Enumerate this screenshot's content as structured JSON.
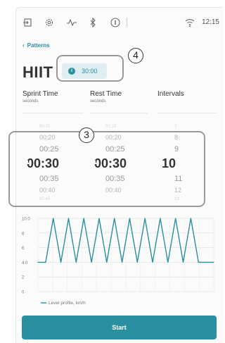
{
  "status_bar": {
    "icons": [
      "exit-icon",
      "settings-gear-icon",
      "heart-rate-icon",
      "bluetooth-icon",
      "info-icon",
      "wifi-icon"
    ],
    "time": "12:15"
  },
  "header": {
    "back_label": "Patterns",
    "title": "HIIT",
    "duration": "30:00"
  },
  "annotations": {
    "box_4": "4",
    "box_3": "3"
  },
  "columns": [
    {
      "title": "Sprint Time",
      "subtitle": "seconds"
    },
    {
      "title": "Rest Time",
      "subtitle": "seconds"
    },
    {
      "title": "Intervals",
      "subtitle": ""
    }
  ],
  "pickers": {
    "sprint": {
      "above": [
        "00:20",
        "00:25"
      ],
      "selected": "00:30",
      "below": [
        "00:35",
        "00:40"
      ]
    },
    "rest": {
      "above": [
        "00:20",
        "00:25"
      ],
      "selected": "00:30",
      "below": [
        "00:35",
        "00:40"
      ]
    },
    "intervals": {
      "above": [
        "8",
        "9"
      ],
      "selected": "10",
      "below": [
        "11",
        "12"
      ]
    }
  },
  "chart_data": {
    "type": "line",
    "ylim": [
      0,
      10
    ],
    "yticks": [
      "10.0",
      "8",
      "6",
      "4.0",
      "2",
      "0"
    ],
    "legend": "Level profile, km/h",
    "series": [
      {
        "name": "Level profile, km/h",
        "x": [
          0,
          1,
          2,
          3,
          4,
          5,
          6,
          7,
          8,
          9,
          10,
          11,
          12,
          13,
          14,
          15,
          16,
          17,
          18,
          19,
          20,
          21,
          22,
          23
        ],
        "values": [
          4.0,
          4.0,
          10.0,
          4.0,
          10.0,
          4.0,
          10.0,
          4.0,
          10.0,
          4.0,
          10.0,
          4.0,
          10.0,
          4.0,
          10.0,
          4.0,
          10.0,
          4.0,
          10.0,
          4.0,
          10.0,
          4.0,
          4.0,
          4.0
        ]
      }
    ],
    "colors": {
      "line": "#2a8fa0",
      "grid": "#e8e8e8"
    }
  },
  "footer": {
    "start_label": "Start"
  },
  "colors": {
    "accent": "#2a8fa0",
    "clock": "#7a6df0"
  }
}
